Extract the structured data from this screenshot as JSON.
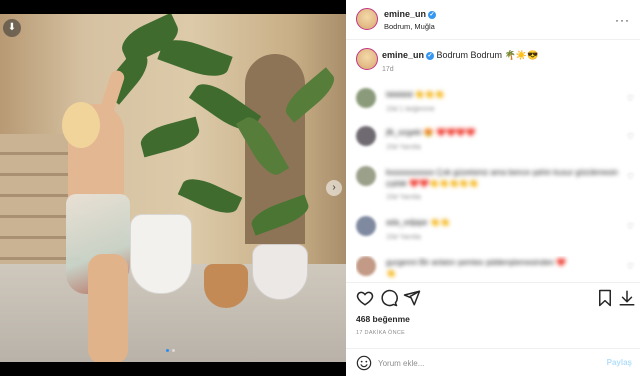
{
  "post": {
    "username": "emine_un",
    "location": "Bodrum, Muğla",
    "caption_user": "emine_un",
    "caption_text": "Bodrum Bodrum 🌴☀️😎",
    "caption_age": "17d",
    "likes": "468 beğenme",
    "posted_ago": "17 DAKİKA ÖNCE",
    "comment_placeholder": "Yorum ekle...",
    "post_label": "Paylaş"
  },
  "photo": {
    "slide_count": 2,
    "active_slide": 1
  },
  "comments": [
    {
      "text": "lalalalal 👏👏👏",
      "meta": "15d  1 beğenme"
    },
    {
      "text": "jfk_ezgeki 😍 ❤️❤️❤️❤️",
      "meta": "15d  Yanıtla"
    },
    {
      "text": "ksssssssssso Çok güzelsiniz ama bence şahin kusur gözükmesin",
      "meta": "15d  Yanıtla",
      "text2": "çıplak ❤️❤️👏👏👏👏👏"
    },
    {
      "text": "ada_edjajar 👏👏",
      "meta": "15d  Yanıtla"
    },
    {
      "text": "gurgenni Bir anlatın şemtes şiddenşlemesinden ❤️",
      "meta": "15d  Yanıtla",
      "text2": "👏"
    }
  ],
  "icons": {
    "download": "download-icon",
    "next": "chevron-right-icon",
    "more": "more-options-icon",
    "like": "heart-icon",
    "comment": "comment-icon",
    "share": "send-icon",
    "save": "bookmark-icon",
    "emoji": "emoji-icon"
  },
  "colors": {
    "verified": "#3897f0",
    "post_button_disabled": "#b2dffc",
    "active_dot": "#2f8cf0"
  }
}
